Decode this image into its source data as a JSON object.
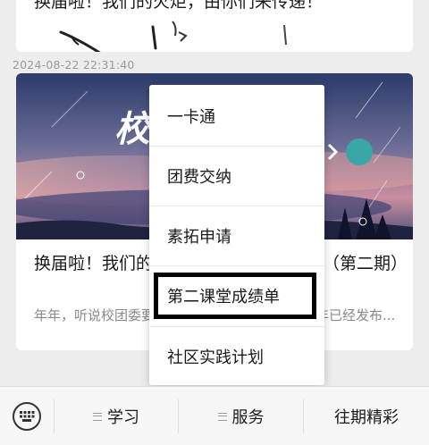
{
  "previous_article": {
    "title": "换届啦！我们的火炬，由你们来传递！"
  },
  "timestamp": "2024-08-22 22:31:40",
  "article": {
    "title": "换届啦！我们的火炬，由你们来传递！（第二期）",
    "description": "年年，听说校团委要换届了？换届了？嗯嗯，年年已经发布...",
    "banner_text": "校"
  },
  "menu": {
    "items": [
      {
        "label": "一卡通"
      },
      {
        "label": "团费交纳"
      },
      {
        "label": "素拓申请"
      },
      {
        "label": "第二课堂成绩单"
      },
      {
        "label": "社区实践计划"
      }
    ]
  },
  "bottom_nav": {
    "keyboard_icon": "keyboard-icon",
    "tabs": [
      {
        "label": "学习",
        "has_menu": true
      },
      {
        "label": "服务",
        "has_menu": true
      },
      {
        "label": "往期精彩",
        "has_menu": false
      }
    ]
  },
  "colors": {
    "background": "#ededed",
    "highlight_border": "#000000",
    "banner_sky_top": "#2f3f6e",
    "banner_sky_bottom": "#c98a9c",
    "teal_dot": "#3aa6a6"
  }
}
